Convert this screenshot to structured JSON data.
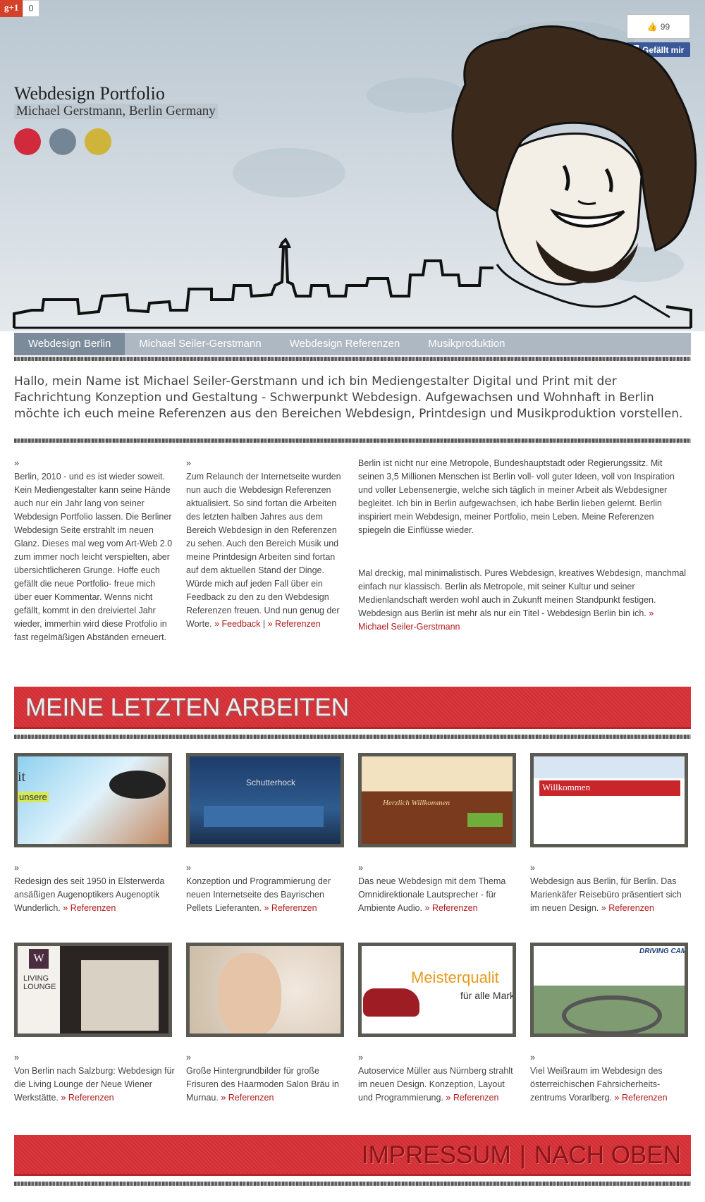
{
  "social": {
    "gplus_label": "g+1",
    "gplus_count": "0",
    "fb_count": "99",
    "fb_like_label": "Gefällt mir"
  },
  "header": {
    "title": "Webdesign Portfolio",
    "subtitle": "Michael Gerstmann, Berlin Germany",
    "dot_colors": [
      "#d12a3c",
      "#748695",
      "#cfb43c"
    ]
  },
  "nav": {
    "items": [
      {
        "label": "Webdesign Berlin"
      },
      {
        "label": "Michael Seiler-Gerstmann"
      },
      {
        "label": "Webdesign Referenzen"
      },
      {
        "label": "Musikproduktion"
      }
    ]
  },
  "intro": "Hallo, mein Name ist Michael Seiler-Gerstmann und ich bin Mediengestalter Digital und Print mit der Fachrichtung Konzeption und Gestaltung - Schwerpunkt Webdesign. Aufgewachsen und Wohnhaft in Berlin möchte ich euch meine Referenzen aus den Bereichen Webdesign, Printdesign und Musikproduktion vorstellen.",
  "columns": {
    "arrow": "»",
    "col1": "Berlin, 2010 - und es ist wieder soweit. Kein Mediengestalter kann seine Hände auch nur ein Jahr lang von seiner Webdesign Portfolio lassen. Die Berliner Webdesign Seite erstrahlt im neuen Glanz. Dieses mal weg vom Art-Web 2.0 zum immer noch leicht verspielten, aber übersichtlicheren Grunge. Hoffe euch gefällt die neue Portfolio- freue mich über euer Kommentar. Wenns nicht gefällt, kommt in den dreiviertel Jahr wieder, immerhin wird diese Protfolio in fast regelmäßigen Abständen erneuert.",
    "col2_text": "Zum Relaunch der Internetseite wurden nun auch die Webdesign Referenzen aktualisiert. So sind fortan die Arbeiten des letzten halben Jahres aus dem Bereich Webdesign in den Referenzen zu sehen. Auch den Bereich Musik und meine Printdesign Arbeiten sind fortan auf dem aktuellen Stand der Dinge. Würde mich auf jeden Fall über ein Feedback zu den zu den Webdesign Referenzen freuen. Und nun genug der Worte.",
    "col2_link1": "» Feedback",
    "col2_sep": "|",
    "col2_link2": "» Referenzen",
    "col3_p1": "Berlin ist nicht nur eine Metropole, Bundeshauptstadt oder Regierungssitz. Mit seinen 3,5 Millionen Menschen ist Berlin voll- voll guter Ideen, voll von Inspiration und voller Lebensenergie, welche sich täglich in meiner Arbeit als Webdesigner begleitet. Ich bin in Berlin aufgewachsen, ich habe Berlin lieben gelernt. Berlin inspiriert mein Webdesign, meiner Portfolio, mein Leben. Meine Referenzen spiegeln die Einflüsse wieder.",
    "col3_p2": "Mal dreckig, mal minimalistisch. Pures Webdesign, kreatives Webdesign, manchmal einfach nur klassisch. Berlin als Metropole, mit seiner Kultur und seiner Medienlandschaft werden wohl auch in Zukunft meinen Standpunkt festigen. Webdesign aus Berlin ist mehr als nur ein Titel - Webdesign Berlin bin ich.",
    "col3_link": "» Michael Seiler-Gerstmann"
  },
  "works": {
    "heading": "MEINE LETZTEN ARBEITEN",
    "link_label": "» Referenzen",
    "items": [
      {
        "text": "Redesign des seit 1950 in Elsterwerda ansäßigen Augenoptikers Augenoptik Wunderlich.",
        "thumb_text": "unsere",
        "thumb_text2": "it"
      },
      {
        "text": "Konzeption und Programmierung der neuen Internetseite des Bayrischen Pellets Lieferanten.",
        "thumb_text": "Schutterhock"
      },
      {
        "text": "Das neue Webdesign mit dem Thema Omnidirektionale Lautsprecher - für Ambiente Audio.",
        "thumb_text": "Herzlich Willkommen"
      },
      {
        "text": "Webdesign aus Berlin, für Berlin. Das Marienkäfer Reisebüro präsentiert sich im neuen Design.",
        "thumb_text": "Willkommen"
      },
      {
        "text": "Von Berlin nach Salzburg: Webdesign für die Living Lounge der Neue Wiener Werkstätte.",
        "thumb_text": "LIVING LOUNGE",
        "thumb_text2": "W"
      },
      {
        "text": "Große Hintergrundbilder für große Frisuren des Haarmoden Salon Bräu in Murnau.",
        "thumb_text": ""
      },
      {
        "text": "Autoservice Müller aus Nürnberg strahlt im neuen Design. Konzeption, Layout und Programmierung.",
        "thumb_text": "Meisterqualit",
        "thumb_text2": "für alle Mark"
      },
      {
        "text": "Viel Weißraum im Webdesign des österreichischen Fahrsicherheits-zentrums Vorarlberg.",
        "thumb_text": "DRIVING CAM"
      }
    ]
  },
  "footer": {
    "impressum": "IMPRESSUM",
    "sep": "|",
    "top": "NACH OBEN"
  }
}
